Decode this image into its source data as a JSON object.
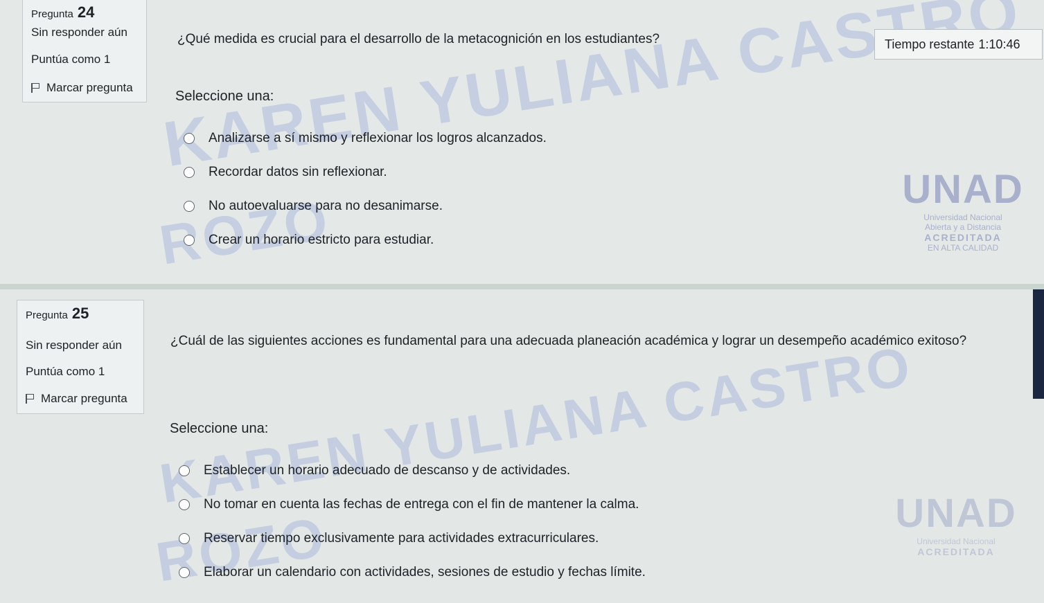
{
  "timer": {
    "label": "Tiempo restante",
    "value": "1:10:46"
  },
  "questions": [
    {
      "number_label": "Pregunta",
      "number": "24",
      "status": "Sin responder aún",
      "score": "Puntúa como 1",
      "flag_label": "Marcar pregunta",
      "text": "¿Qué medida es crucial para el desarrollo de la metacognición en los estudiantes?",
      "prompt": "Seleccione una:",
      "options": [
        "Analizarse a sí mismo y reflexionar los logros alcanzados.",
        "Recordar datos sin reflexionar.",
        "No autoevaluarse para no desanimarse.",
        "Crear un horario estricto para estudiar."
      ]
    },
    {
      "number_label": "Pregunta",
      "number": "25",
      "status": "Sin responder aún",
      "score": "Puntúa como 1",
      "flag_label": "Marcar pregunta",
      "text": "¿Cuál de las siguientes acciones es fundamental para una adecuada planeación académica y lograr un desempeño académico exitoso?",
      "prompt": "Seleccione una:",
      "options": [
        "Establecer un horario adecuado de descanso y de actividades.",
        "No tomar en cuenta las fechas de entrega con el fin de mantener la calma.",
        "Reservar tiempo exclusivamente para actividades extracurriculares.",
        "Elaborar un calendario con actividades, sesiones de estudio y fechas límite."
      ]
    }
  ],
  "watermark": {
    "line1": "KAREN YULIANA CASTRO",
    "line2": "ROZO"
  },
  "logo": {
    "name": "UNAD",
    "line1": "Universidad Nacional",
    "line2": "Abierta y a Distancia",
    "line3": "ACREDITADA",
    "line4": "EN ALTA CALIDAD"
  },
  "colors": {
    "page": "#e4e9e8",
    "watermark": "#788cd2",
    "scrollbar": "#1b2740"
  }
}
